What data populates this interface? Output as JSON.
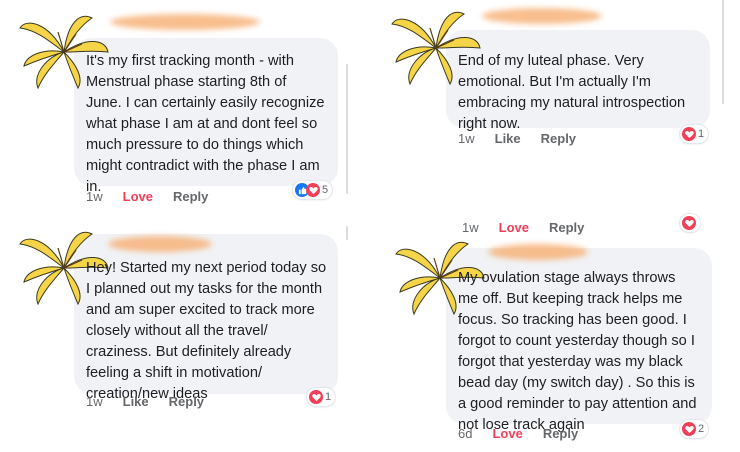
{
  "colors": {
    "bubble": "#f0f2f5",
    "text": "#1c1e21",
    "meta": "#65676b",
    "love": "#f33e58",
    "like_blue": "#1877f2",
    "lily_yellow": "#f5d547",
    "redaction_orange": "#f7b37a"
  },
  "comments": [
    {
      "text": "It's my first tracking month  - with\nMenstrual phase starting 8th of\nJune. I can certainly easily recognize\nwhat phase I am at and dont feel so\nmuch pressure to do things which\nmight contradict with the phase I am\nin.",
      "time": "1w",
      "like_label": "Love",
      "reply_label": "Reply",
      "reactions": [
        "like-icon",
        "heart-icon"
      ],
      "reaction_count": "5"
    },
    {
      "text": "End of my luteal phase. Very\nemotional. But I'm actually I'm\nembracing my natural introspection\nright now.",
      "time": "1w",
      "like_label": "Like",
      "reply_label": "Reply",
      "reactions": [
        "heart-icon"
      ],
      "reaction_count": "1"
    },
    {
      "text": "Hey! Started my next period today so\nI planned out my tasks for the month\nand am super excited to track more\nclosely without all the travel/\ncraziness. But definitely already\nfeeling a shift in motivation/\ncreation/new ideas",
      "time": "1w",
      "like_label": "Like",
      "reply_label": "Reply",
      "reactions": [
        "heart-icon"
      ],
      "reaction_count": "1"
    },
    {
      "text": "My ovulation stage always throws\nme off. But keeping track helps me\nfocus. So tracking has been good. I\nforgot to count yesterday though so I\nforgot that yesterday was my black\nbead day (my switch day) . So this is\na good reminder to pay attention and\nnot lose track again",
      "time": "6d",
      "like_label": "Love",
      "reply_label": "Reply",
      "reactions": [
        "heart-icon"
      ],
      "reaction_count": "2"
    }
  ],
  "cropped_above_last": {
    "time": "1w",
    "like_label": "Love",
    "reply_label": "Reply"
  }
}
